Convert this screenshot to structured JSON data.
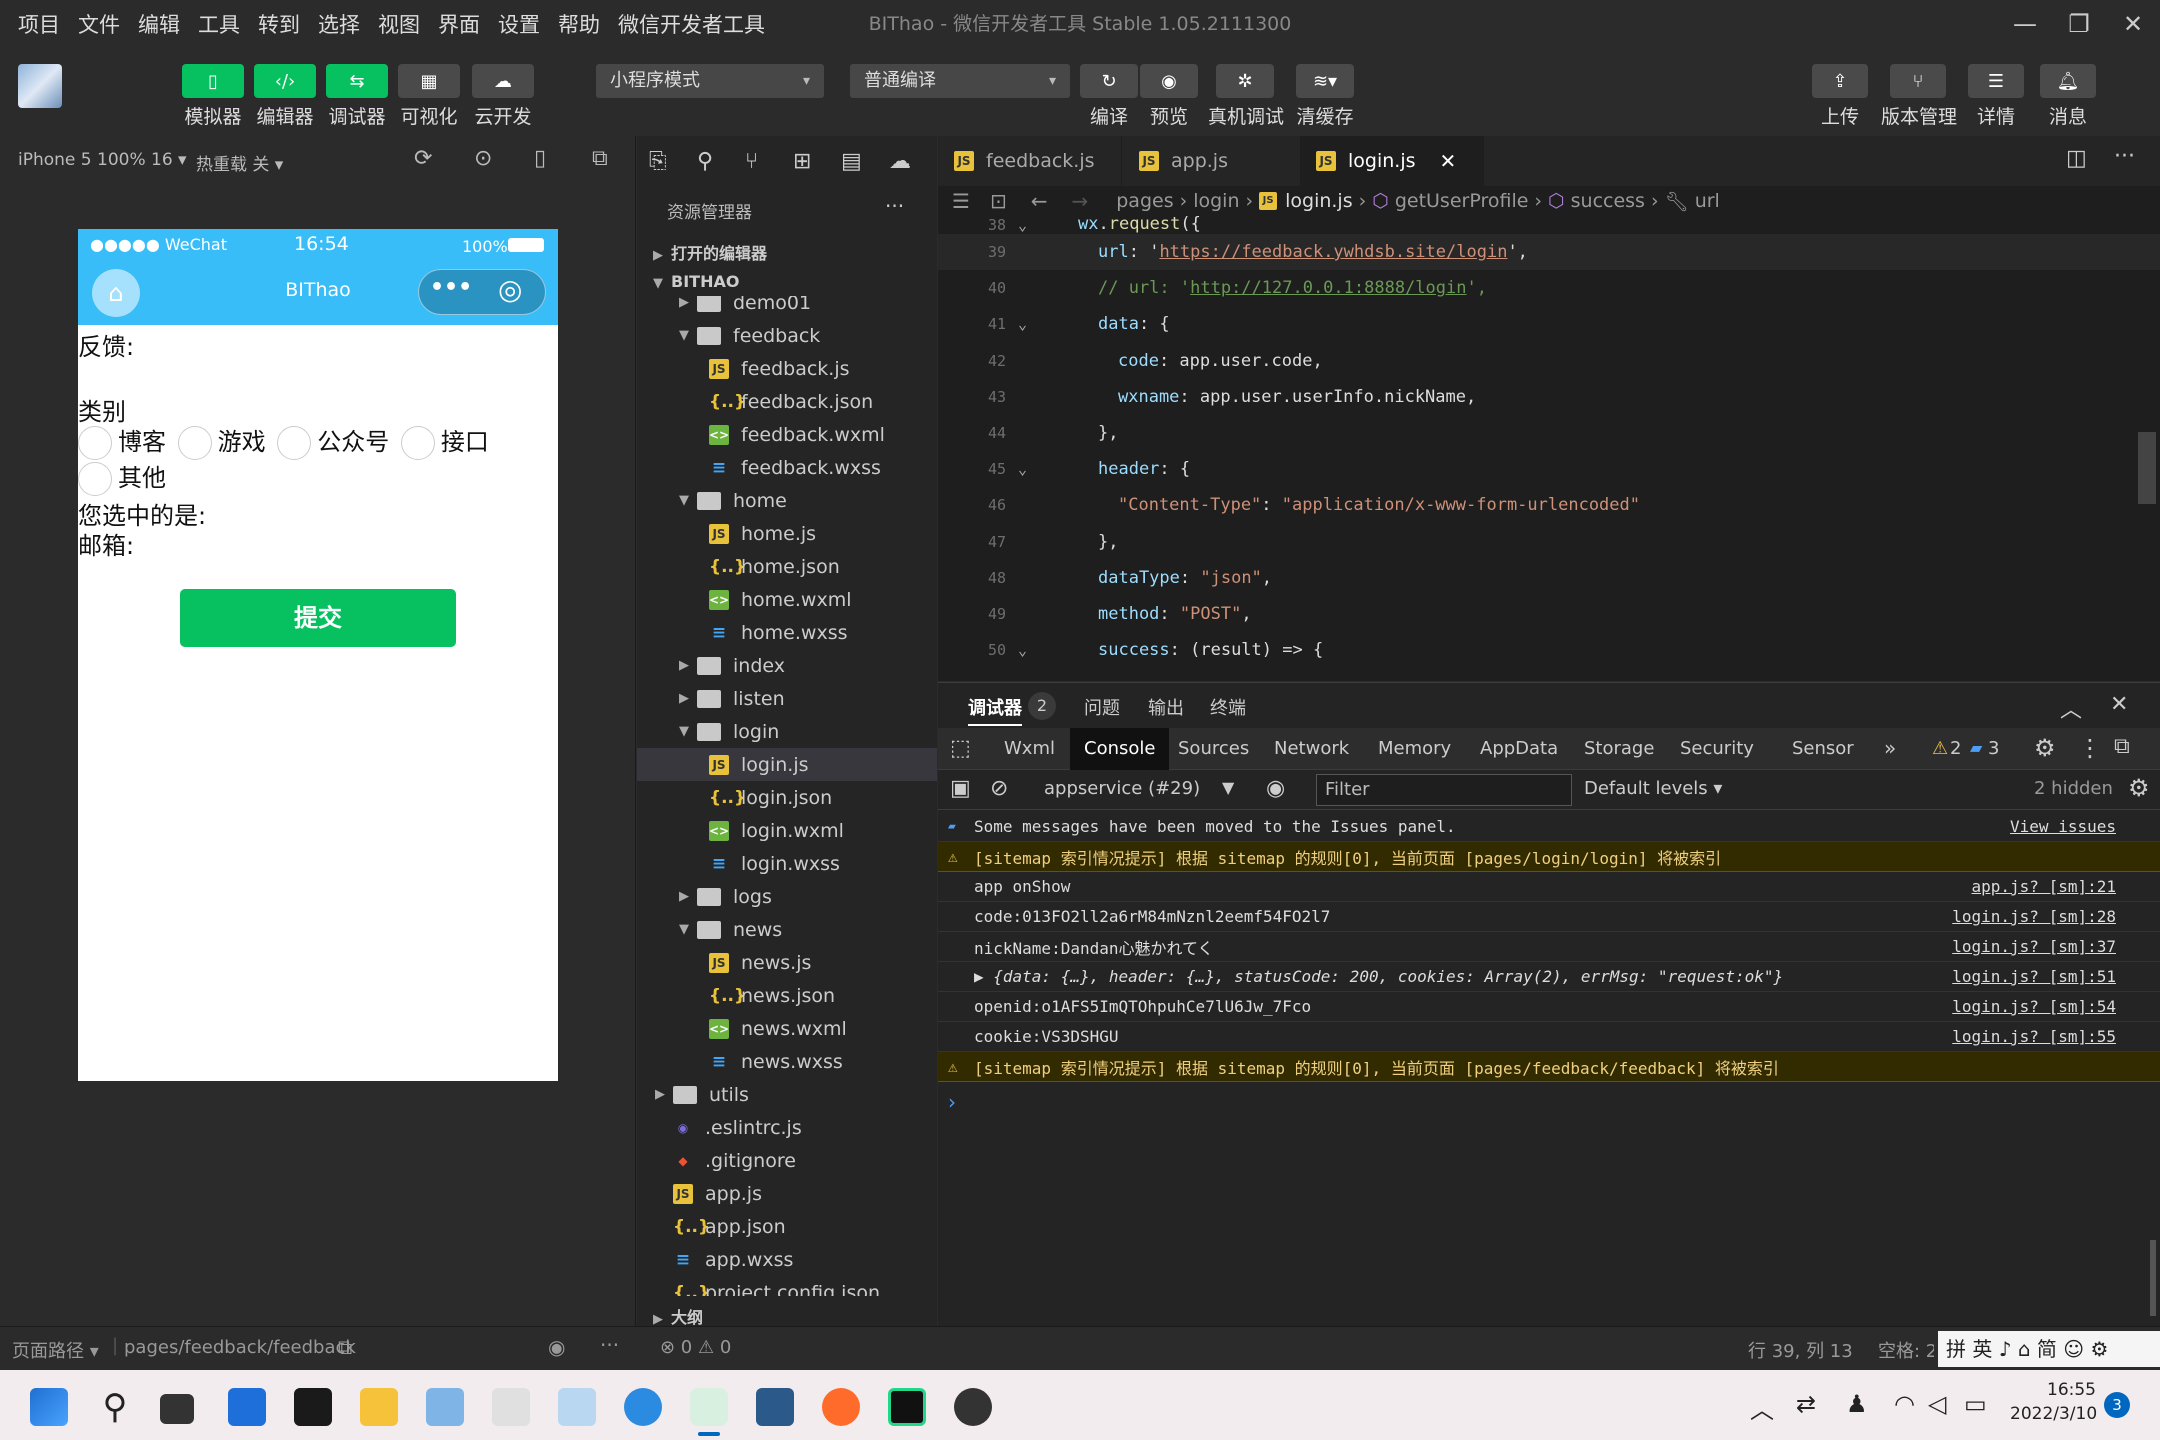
{
  "menu": [
    "项目",
    "文件",
    "编辑",
    "工具",
    "转到",
    "选择",
    "视图",
    "界面",
    "设置",
    "帮助",
    "微信开发者工具"
  ],
  "window_title": "BIThao - 微信开发者工具 Stable 1.05.2111300",
  "toolbar": {
    "left_buttons": [
      "模拟器",
      "编辑器",
      "调试器",
      "可视化",
      "云开发"
    ],
    "mode_select": "小程序模式",
    "compile_select": "普通编译",
    "mid_buttons": [
      "编译",
      "预览",
      "真机调试",
      "清缓存"
    ],
    "right_buttons": [
      "上传",
      "版本管理",
      "详情",
      "消息"
    ]
  },
  "simulator": {
    "device": "iPhone 5 100% 16 ▾",
    "hotreload": "热重载 关 ▾",
    "status_carrier": "●●●●● WeChat",
    "status_time": "16:54",
    "status_battery": "100%",
    "nav_title": "BIThao",
    "feedback_label": "反馈:",
    "category_label": "类别",
    "options": [
      "博客",
      "游戏",
      "公众号",
      "接口",
      "其他"
    ],
    "selected_label": "您选中的是:",
    "email_label": "邮箱:",
    "submit": "提交"
  },
  "explorer": {
    "title": "资源管理器",
    "open_editors": "打开的编辑器",
    "project": "BITHAO",
    "items": [
      {
        "name": "demo01",
        "type": "folder",
        "depth": 1,
        "open": false
      },
      {
        "name": "feedback",
        "type": "folder",
        "depth": 1,
        "open": true
      },
      {
        "name": "feedback.js",
        "type": "js",
        "depth": 2
      },
      {
        "name": "feedback.json",
        "type": "json",
        "depth": 2
      },
      {
        "name": "feedback.wxml",
        "type": "wxml",
        "depth": 2
      },
      {
        "name": "feedback.wxss",
        "type": "wxss",
        "depth": 2
      },
      {
        "name": "home",
        "type": "folder",
        "depth": 1,
        "open": true
      },
      {
        "name": "home.js",
        "type": "js",
        "depth": 2
      },
      {
        "name": "home.json",
        "type": "json",
        "depth": 2
      },
      {
        "name": "home.wxml",
        "type": "wxml",
        "depth": 2
      },
      {
        "name": "home.wxss",
        "type": "wxss",
        "depth": 2
      },
      {
        "name": "index",
        "type": "folder",
        "depth": 1,
        "open": false
      },
      {
        "name": "listen",
        "type": "folder",
        "depth": 1,
        "open": false
      },
      {
        "name": "login",
        "type": "folder",
        "depth": 1,
        "open": true
      },
      {
        "name": "login.js",
        "type": "js",
        "depth": 2,
        "selected": true
      },
      {
        "name": "login.json",
        "type": "json",
        "depth": 2
      },
      {
        "name": "login.wxml",
        "type": "wxml",
        "depth": 2
      },
      {
        "name": "login.wxss",
        "type": "wxss",
        "depth": 2
      },
      {
        "name": "logs",
        "type": "folder",
        "depth": 1,
        "open": false
      },
      {
        "name": "news",
        "type": "folder",
        "depth": 1,
        "open": true
      },
      {
        "name": "news.js",
        "type": "js",
        "depth": 2
      },
      {
        "name": "news.json",
        "type": "json",
        "depth": 2
      },
      {
        "name": "news.wxml",
        "type": "wxml",
        "depth": 2
      },
      {
        "name": "news.wxss",
        "type": "wxss",
        "depth": 2
      },
      {
        "name": "utils",
        "type": "folder",
        "depth": 0,
        "open": false
      },
      {
        "name": ".eslintrc.js",
        "type": "eslint",
        "depth": 0
      },
      {
        "name": ".gitignore",
        "type": "git",
        "depth": 0
      },
      {
        "name": "app.js",
        "type": "js",
        "depth": 0
      },
      {
        "name": "app.json",
        "type": "json",
        "depth": 0
      },
      {
        "name": "app.wxss",
        "type": "wxss",
        "depth": 0
      },
      {
        "name": "project.config.json",
        "type": "json",
        "depth": 0
      }
    ],
    "outline": "大纲"
  },
  "editor": {
    "tabs": [
      "feedback.js",
      "app.js",
      "login.js"
    ],
    "active_tab": "login.js",
    "breadcrumb": [
      "pages",
      "login",
      "login.js",
      "getUserProfile",
      "success",
      "url"
    ],
    "lines": [
      {
        "n": "38",
        "text": "wx.request({"
      },
      {
        "n": "39",
        "text": "url: 'https://feedback.ywhdsb.site/login',"
      },
      {
        "n": "40",
        "text": "// url: 'http://127.0.0.1:8888/login',"
      },
      {
        "n": "41",
        "text": "data: {"
      },
      {
        "n": "42",
        "text": "code: app.user.code,"
      },
      {
        "n": "43",
        "text": "wxname: app.user.userInfo.nickName,"
      },
      {
        "n": "44",
        "text": "},"
      },
      {
        "n": "45",
        "text": "header: {"
      },
      {
        "n": "46",
        "text": "\"Content-Type\": \"application/x-www-form-urlencoded\""
      },
      {
        "n": "47",
        "text": "},"
      },
      {
        "n": "48",
        "text": "dataType: \"json\","
      },
      {
        "n": "49",
        "text": "method: \"POST\","
      },
      {
        "n": "50",
        "text": "success: (result) => {"
      }
    ]
  },
  "devtools": {
    "panel_tabs": [
      "调试器",
      "问题",
      "输出",
      "终端"
    ],
    "debugger_badge": "2",
    "tabs": [
      "Wxml",
      "Console",
      "Sources",
      "Network",
      "Memory",
      "AppData",
      "Storage",
      "Security",
      "Sensor"
    ],
    "active_tab": "Console",
    "warn_count": "2",
    "info_count": "3",
    "context": "appservice (#29)",
    "filter_placeholder": "Filter",
    "levels": "Default levels ▾",
    "hidden": "2 hidden",
    "console": [
      {
        "type": "info",
        "text": "Some messages have been moved to the Issues panel.",
        "src": "View issues"
      },
      {
        "type": "warn",
        "text": "[sitemap 索引情况提示] 根据 sitemap 的规则[0], 当前页面 [pages/login/login] 将被索引",
        "src": ""
      },
      {
        "type": "log",
        "text": "app onShow",
        "src": "app.js? [sm]:21"
      },
      {
        "type": "log",
        "text": "code:013FO2ll2a6rM84mNznl2eemf54FO2l7",
        "src": "login.js? [sm]:28"
      },
      {
        "type": "log",
        "text": "nickName:Dandan心魅かれてく",
        "src": "login.js? [sm]:37"
      },
      {
        "type": "log",
        "text": "▶ {data: {…}, header: {…}, statusCode: 200, cookies: Array(2), errMsg: \"request:ok\"}",
        "src": "login.js? [sm]:51"
      },
      {
        "type": "log",
        "text": "openid:o1AFS5ImQTOhpuhCe7lU6Jw_7Fco",
        "src": "login.js? [sm]:54"
      },
      {
        "type": "log",
        "text": "cookie:VS3DSHGU",
        "src": "login.js? [sm]:55"
      },
      {
        "type": "warn",
        "text": "[sitemap 索引情况提示] 根据 sitemap 的规则[0], 当前页面 [pages/feedback/feedback] 将被索引",
        "src": ""
      }
    ]
  },
  "status": {
    "path_label": "页面路径 ▾",
    "path": "pages/feedback/feedback",
    "errors": "⊗ 0 ⚠ 0",
    "position": "行 39, 列 13",
    "spaces": "空格: 2",
    "ime": "拼 英 ♪ ⌂ 简 ☺ ⚙"
  },
  "taskbar": {
    "time": "16:55",
    "date": "2022/3/10",
    "notif": "3"
  }
}
